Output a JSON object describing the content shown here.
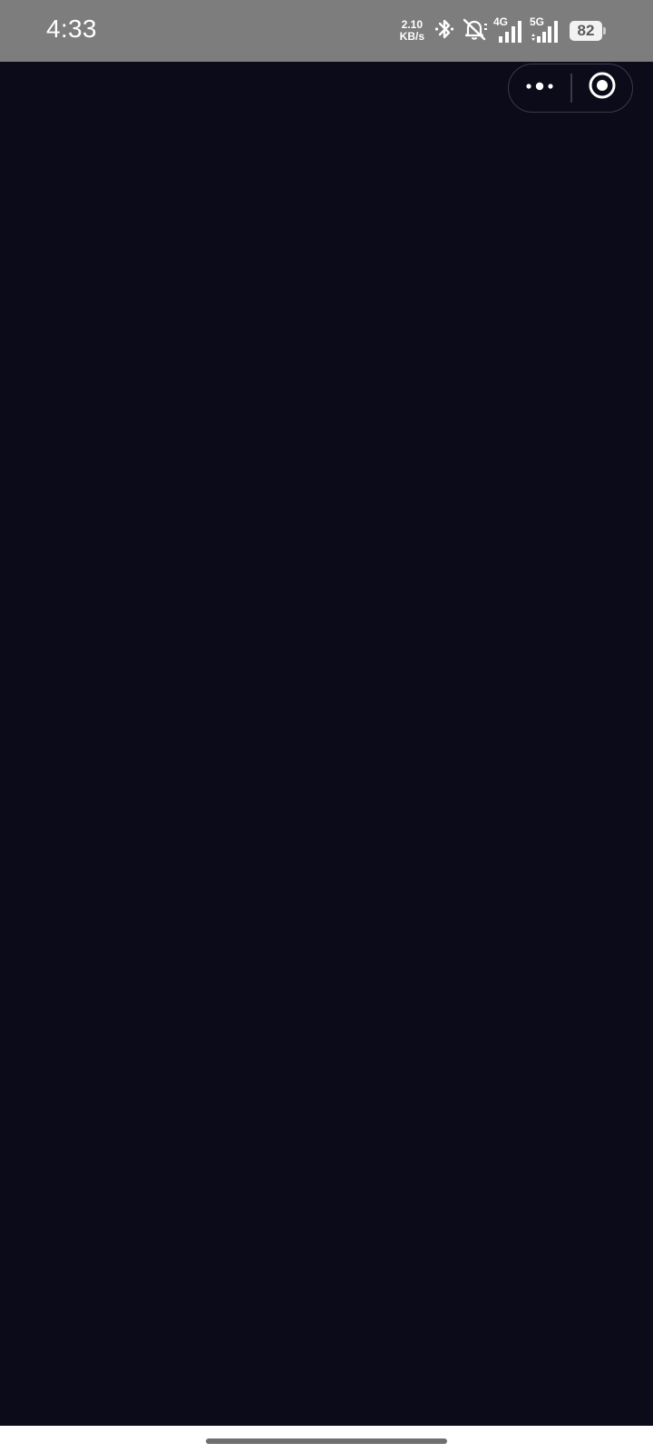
{
  "status_bar": {
    "time": "4:33",
    "net_speed_value": "2.10",
    "net_speed_unit": "KB/s",
    "signal_1_label": "4G",
    "signal_2_label": "5G",
    "battery_level": "82",
    "icons": [
      "bluetooth-icon",
      "silent-bell-icon",
      "signal-4g-icon",
      "signal-5g-icon",
      "battery-icon"
    ]
  },
  "capsule": {
    "icons": [
      "more-dots-icon",
      "close-target-icon"
    ]
  },
  "colors": {
    "status_bar_bg": "#7d7d7d",
    "content_bg": "#0b0b1a",
    "capsule_border": "#3a3a4c",
    "nav_bg": "#ffffff",
    "home_indicator": "#6f6f6f"
  }
}
